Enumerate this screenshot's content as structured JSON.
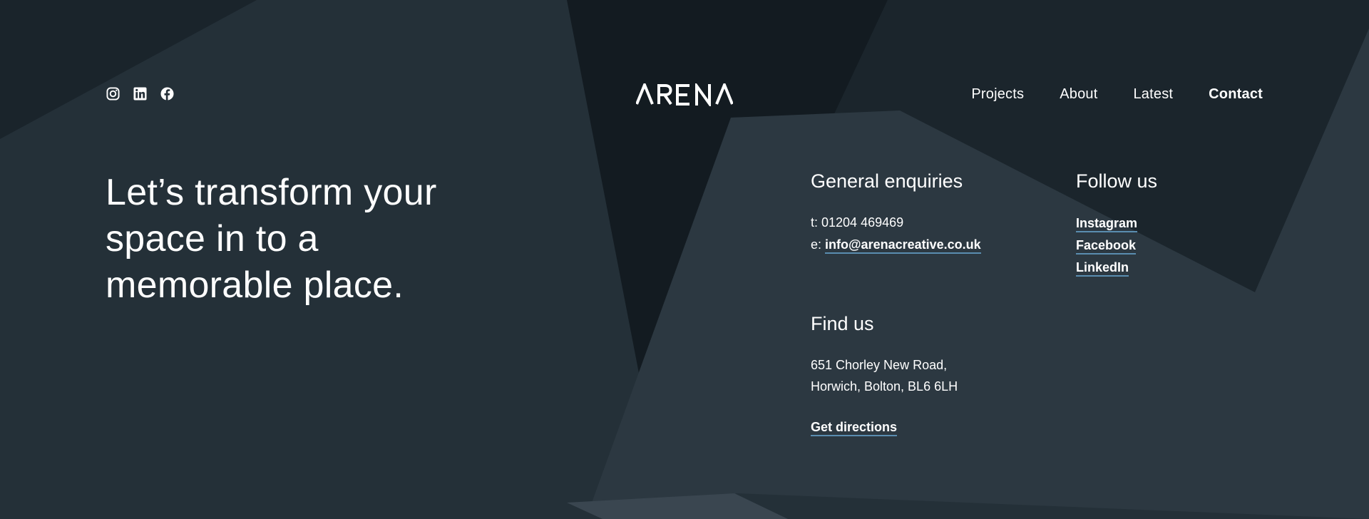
{
  "header": {
    "social_icons": [
      {
        "icon": "instagram-icon"
      },
      {
        "icon": "linkedin-icon"
      },
      {
        "icon": "facebook-icon"
      }
    ],
    "logo_text": "ARENA",
    "nav": [
      {
        "label": "Projects",
        "active": false
      },
      {
        "label": "About",
        "active": false
      },
      {
        "label": "Latest",
        "active": false
      },
      {
        "label": "Contact",
        "active": true
      }
    ]
  },
  "hero": {
    "lines": [
      "Let’s transform your",
      "space in to a",
      "memorable place."
    ]
  },
  "enquiries": {
    "title": "General enquiries",
    "phone_prefix": "t: ",
    "phone": "01204 469469",
    "email_prefix": "e: ",
    "email": "info@arenacreative.co.uk"
  },
  "follow": {
    "title": "Follow us",
    "links": [
      "Instagram",
      "Facebook",
      "LinkedIn"
    ]
  },
  "find": {
    "title": "Find us",
    "address_line1": "651 Chorley New Road,",
    "address_line2": "Horwich, Bolton, BL6 6LH",
    "directions": "Get directions"
  },
  "colors": {
    "background": "#253039",
    "dark_shape": "#141b21",
    "light_shape": "#2d3943",
    "link_underline": "#5a8db0"
  }
}
